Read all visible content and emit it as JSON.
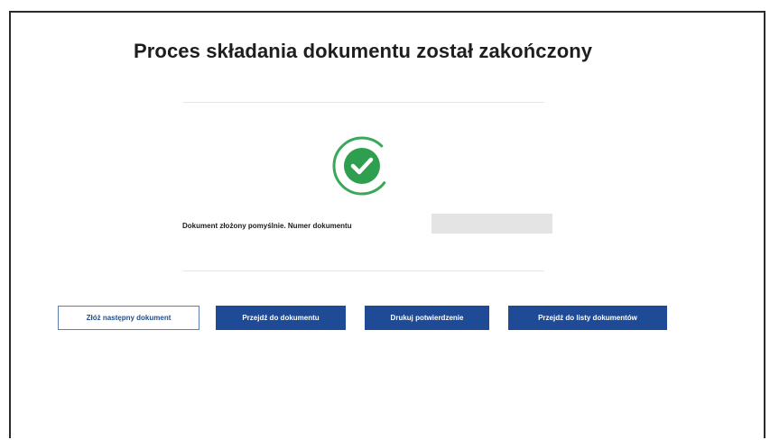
{
  "header": {
    "title": "Proces składania dokumentu został zakończony"
  },
  "status": {
    "icon": "check-circle-icon",
    "accent_color": "#2e9e4f",
    "message": "Dokument złożony pomyślnie. Numer dokumentu",
    "document_number": ""
  },
  "actions": {
    "submit_next_label": "Złóż następny dokument",
    "go_to_document_label": "Przejdź do dokumentu",
    "print_confirmation_label": "Drukuj potwierdzenie",
    "go_to_list_label": "Przejdź do listy dokumentów"
  },
  "colors": {
    "primary_button": "#1f4a96",
    "secondary_button_text": "#1f4e8c"
  }
}
